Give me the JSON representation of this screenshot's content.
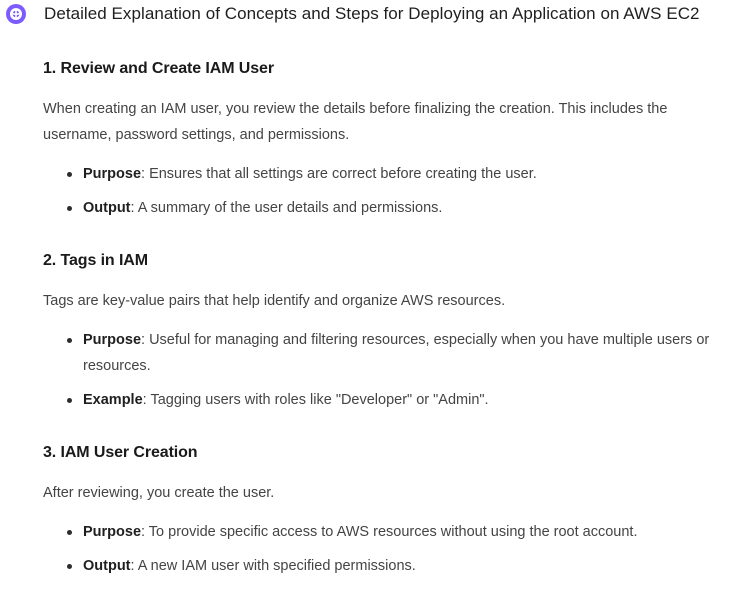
{
  "header": {
    "title": "Detailed Explanation of Concepts and Steps for Deploying an Application on AWS EC2",
    "logo_icon": "chat-assistant-icon",
    "accent_color": "#7c5cff"
  },
  "sections": [
    {
      "heading": "1. Review and Create IAM User",
      "intro": "When creating an IAM user, you review the details before finalizing the creation. This includes the username, password settings, and permissions.",
      "bullets": [
        {
          "label": "Purpose",
          "text": ": Ensures that all settings are correct before creating the user."
        },
        {
          "label": "Output",
          "text": ": A summary of the user details and permissions."
        }
      ]
    },
    {
      "heading": "2. Tags in IAM",
      "intro": "Tags are key-value pairs that help identify and organize AWS resources.",
      "bullets": [
        {
          "label": "Purpose",
          "text": ": Useful for managing and filtering resources, especially when you have multiple users or resources."
        },
        {
          "label": "Example",
          "text": ": Tagging users with roles like \"Developer\" or \"Admin\"."
        }
      ]
    },
    {
      "heading": "3. IAM User Creation",
      "intro": "After reviewing, you create the user.",
      "bullets": [
        {
          "label": "Purpose",
          "text": ": To provide specific access to AWS resources without using the root account."
        },
        {
          "label": "Output",
          "text": ": A new IAM user with specified permissions."
        }
      ]
    }
  ]
}
